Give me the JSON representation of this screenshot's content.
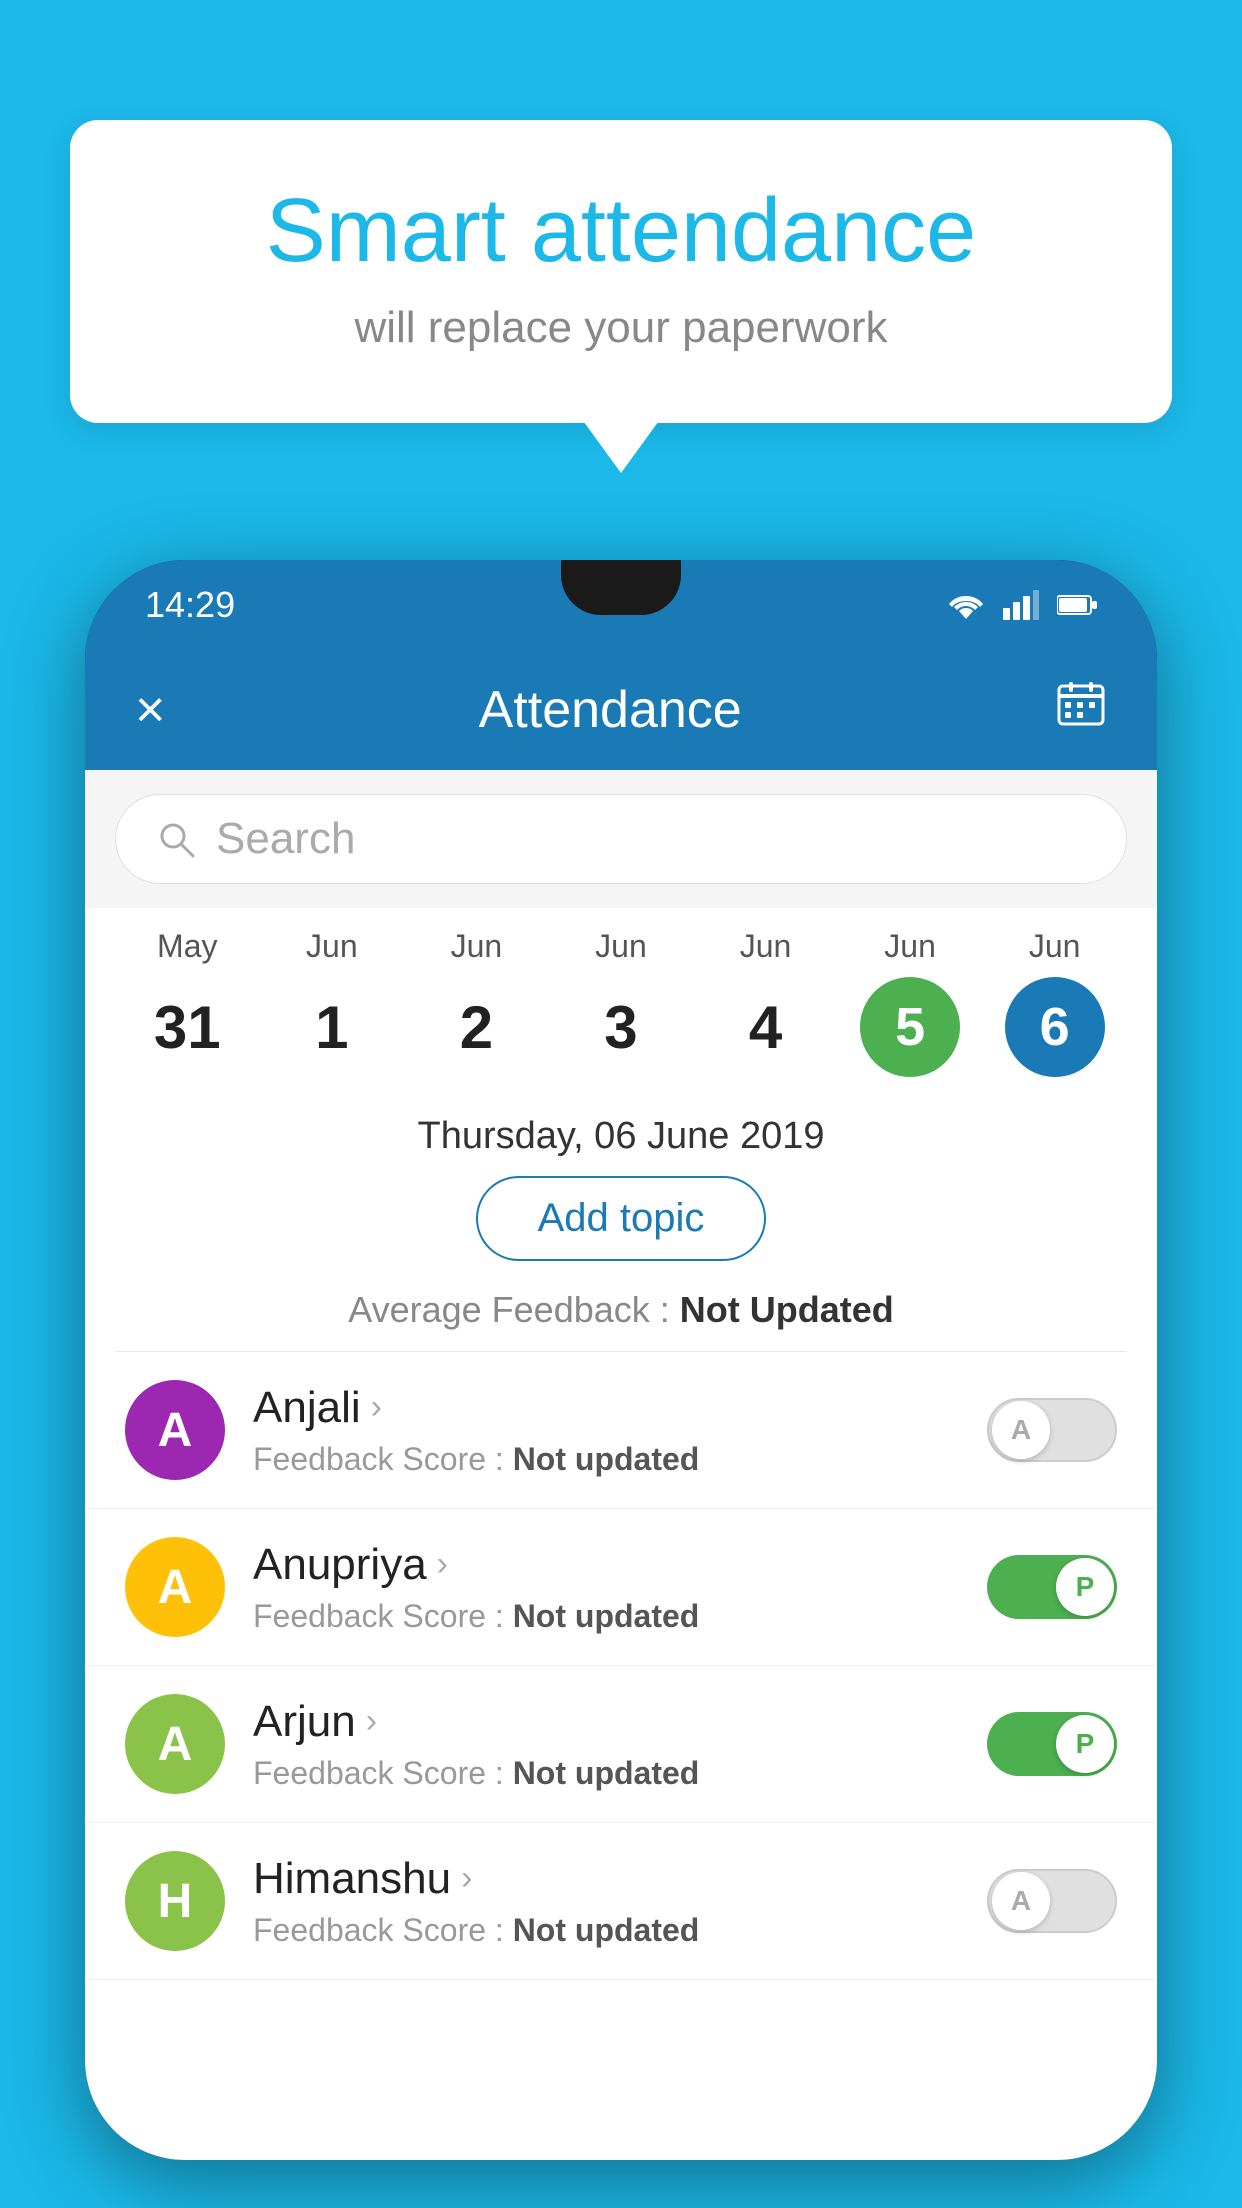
{
  "background_color": "#1BB8E8",
  "bubble": {
    "title": "Smart attendance",
    "subtitle": "will replace your paperwork"
  },
  "status_bar": {
    "time": "14:29",
    "icons": [
      "wifi",
      "signal",
      "battery"
    ]
  },
  "app_bar": {
    "title": "Attendance",
    "close_label": "×",
    "calendar_label": "📅"
  },
  "search": {
    "placeholder": "Search"
  },
  "calendar": {
    "days": [
      {
        "month": "May",
        "date": "31",
        "state": "normal"
      },
      {
        "month": "Jun",
        "date": "1",
        "state": "normal"
      },
      {
        "month": "Jun",
        "date": "2",
        "state": "normal"
      },
      {
        "month": "Jun",
        "date": "3",
        "state": "normal"
      },
      {
        "month": "Jun",
        "date": "4",
        "state": "normal"
      },
      {
        "month": "Jun",
        "date": "5",
        "state": "today"
      },
      {
        "month": "Jun",
        "date": "6",
        "state": "selected"
      }
    ]
  },
  "selected_date_label": "Thursday, 06 June 2019",
  "add_topic_label": "Add topic",
  "avg_feedback_label": "Average Feedback :",
  "avg_feedback_value": "Not Updated",
  "students": [
    {
      "name": "Anjali",
      "avatar_letter": "A",
      "avatar_color": "#9C27B0",
      "feedback_label": "Feedback Score :",
      "feedback_value": "Not updated",
      "toggle_state": "off",
      "toggle_label": "A"
    },
    {
      "name": "Anupriya",
      "avatar_letter": "A",
      "avatar_color": "#FFC107",
      "feedback_label": "Feedback Score :",
      "feedback_value": "Not updated",
      "toggle_state": "on",
      "toggle_label": "P"
    },
    {
      "name": "Arjun",
      "avatar_letter": "A",
      "avatar_color": "#8BC34A",
      "feedback_label": "Feedback Score :",
      "feedback_value": "Not updated",
      "toggle_state": "on",
      "toggle_label": "P"
    },
    {
      "name": "Himanshu",
      "avatar_letter": "H",
      "avatar_color": "#8BC34A",
      "feedback_label": "Feedback Score :",
      "feedback_value": "Not updated",
      "toggle_state": "off",
      "toggle_label": "A"
    }
  ]
}
